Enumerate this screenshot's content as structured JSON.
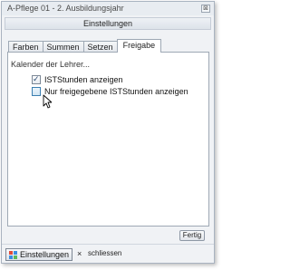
{
  "window": {
    "title": "A-Pflege 01 - 2. Ausbildungsjahr",
    "close_glyph": "⊠",
    "subtitle": "Einstellungen"
  },
  "tabs": [
    {
      "label": "Farben"
    },
    {
      "label": "Summen"
    },
    {
      "label": "Setzen"
    },
    {
      "label": "Freigabe",
      "active": true
    }
  ],
  "panel": {
    "section_label": "Kalender der Lehrer...",
    "checkboxes": [
      {
        "label": "ISTStunden anzeigen",
        "checked": true
      },
      {
        "label": "Nur freigegebene ISTStunden anzeigen",
        "checked": false
      }
    ]
  },
  "buttons": {
    "fertig": "Fertig"
  },
  "bottom": {
    "einstellungen_label": "Einstellungen",
    "close_glyph": "×",
    "schliessen_label": "schliessen"
  },
  "icons": {
    "checkmark_glyph": "✓"
  },
  "colors": {
    "accent": "#3c7fb1",
    "panel_bg": "#ffffff",
    "window_bg": "#f0f2f5"
  }
}
